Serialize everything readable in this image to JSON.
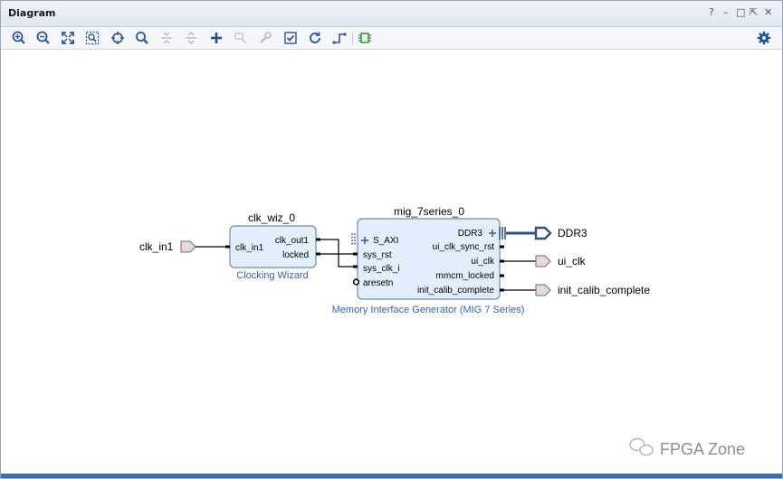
{
  "window": {
    "title": "Diagram",
    "controls": {
      "help": "?",
      "minimize": "–",
      "restore": "□",
      "float": "⇱",
      "close": "✕"
    }
  },
  "toolbar": {
    "buttons": [
      {
        "name": "zoom-in-icon"
      },
      {
        "name": "zoom-out-icon"
      },
      {
        "name": "zoom-fit-icon"
      },
      {
        "name": "zoom-area-icon"
      },
      {
        "name": "auto-connect-icon"
      },
      {
        "name": "search-icon"
      },
      {
        "name": "collapse-all-icon"
      },
      {
        "name": "expand-all-icon"
      },
      {
        "name": "add-ip-icon"
      },
      {
        "name": "run-connection-icon"
      },
      {
        "name": "wrench-icon"
      },
      {
        "name": "validate-icon"
      },
      {
        "name": "regenerate-layout-icon"
      },
      {
        "name": "route-icon"
      },
      {
        "name": "ip-icon"
      },
      {
        "name": "settings-icon"
      }
    ]
  },
  "diagram": {
    "ports": {
      "clk_in1": "clk_in1",
      "ddr3": "DDR3",
      "ui_clk": "ui_clk",
      "init_calib_complete": "init_calib_complete"
    },
    "clk_wiz": {
      "instance": "clk_wiz_0",
      "caption": "Clocking Wizard",
      "pins": {
        "clk_in1": "clk_in1",
        "clk_out1": "clk_out1",
        "locked": "locked"
      }
    },
    "mig": {
      "instance": "mig_7series_0",
      "caption": "Memory Interface Generator (MIG 7 Series)",
      "left_pins": {
        "s_axi": "S_AXI",
        "sys_rst": "sys_rst",
        "sys_clk_i": "sys_clk_i",
        "aresetn": "aresetn"
      },
      "right_pins": {
        "ddr3": "DDR3",
        "ui_clk_sync_rst": "ui_clk_sync_rst",
        "ui_clk": "ui_clk",
        "mmcm_locked": "mmcm_locked",
        "init_calib_complete": "init_calib_complete"
      }
    },
    "colors": {
      "block_fill": "#e2eefb",
      "block_border": "#6f8db8",
      "caption": "#3a62a8",
      "port_fill": "#e9d9d9",
      "wire": "#000000",
      "bus": "#2d4f86"
    }
  },
  "watermark": {
    "text": "FPGA Zone"
  }
}
